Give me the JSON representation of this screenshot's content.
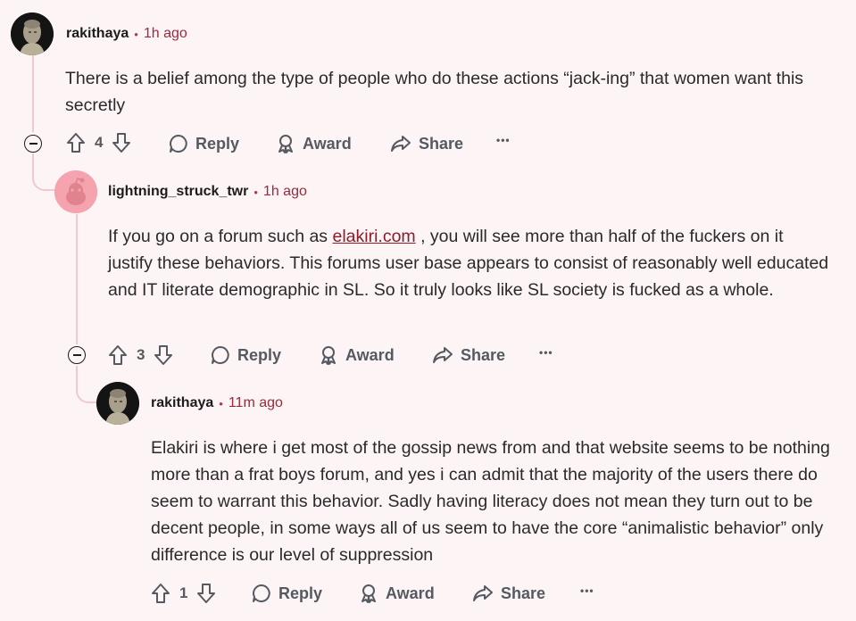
{
  "comments": [
    {
      "author": "rakithaya",
      "time": "1h ago",
      "body": "There is a belief among the type of people who do these actions “jack-ing” that women want this secretly",
      "score": "4",
      "actions": {
        "reply": "Reply",
        "award": "Award",
        "share": "Share"
      }
    },
    {
      "author": "lightning_struck_twr",
      "time": "1h ago",
      "body_before": "If you go on a forum such as ",
      "link": "elakiri.com",
      "body_after": " , you will see more than half of the fuckers on it justify these behaviors. This forums user base appears to consist of reasonably well educated and IT literate demographic in SL. So it truly looks like SL society is fucked as a whole.",
      "score": "3",
      "actions": {
        "reply": "Reply",
        "award": "Award",
        "share": "Share"
      }
    },
    {
      "author": "rakithaya",
      "time": "11m ago",
      "body": "Elakiri is where i get most of the gossip news from and that website seems to be nothing more than a frat boys forum, and yes i can admit that the majority of the users there do seem to warrant this behavior. Sadly having literacy does not mean they turn out to be decent people, in some ways all of us seem to have the core “animalistic behavior” only difference is our level of suppression",
      "score": "1",
      "actions": {
        "reply": "Reply",
        "award": "Award",
        "share": "Share"
      }
    }
  ],
  "separator": "•",
  "more": "•••",
  "icons": {
    "upvote": "upvote-icon",
    "downvote": "downvote-icon",
    "reply": "speech-bubble-icon",
    "award": "award-icon",
    "share": "share-arrow-icon",
    "collapse": "collapse-minus-icon"
  },
  "colors": {
    "background": "#fcf4f5",
    "time": "#9a2a3c",
    "thread": "#f0c9cf",
    "link": "#8e1b2a"
  }
}
